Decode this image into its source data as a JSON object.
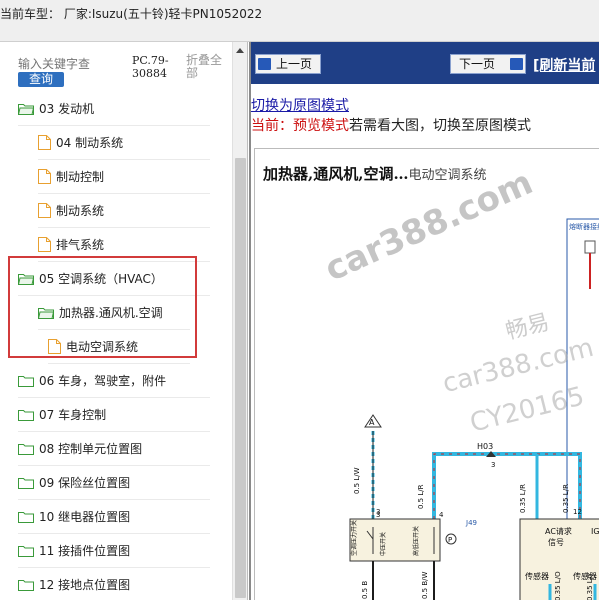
{
  "titlebar": {
    "text": "当前车型： 厂家:Isuzu(五十铃)轻卡PN1052022"
  },
  "sidebar": {
    "search_placeholder": "输入关键字查",
    "search_button": "查询",
    "doc_code": "PC.79-30884",
    "collapse_all": "折叠全部",
    "items": [
      {
        "label": "03 发动机",
        "icon": "folder-icon"
      },
      {
        "label": "04 制动系统",
        "icon": "document-icon"
      },
      {
        "label": "制动控制",
        "icon": "document-icon"
      },
      {
        "label": "制动系统",
        "icon": "document-icon"
      },
      {
        "label": "排气系统",
        "icon": "document-icon"
      },
      {
        "label": "05 空调系统（HVAC）",
        "icon": "folder-icon"
      },
      {
        "label": "加热器.通风机.空调",
        "icon": "folder-icon"
      },
      {
        "label": "电动空调系统",
        "icon": "document-icon"
      },
      {
        "label": "06 车身，驾驶室，附件",
        "icon": "folder-icon"
      },
      {
        "label": "07 车身控制",
        "icon": "folder-icon"
      },
      {
        "label": "08 控制单元位置图",
        "icon": "folder-icon"
      },
      {
        "label": "09 保险丝位置图",
        "icon": "folder-icon"
      },
      {
        "label": "10 继电器位置图",
        "icon": "folder-icon"
      },
      {
        "label": "11 接插件位置图",
        "icon": "folder-icon"
      },
      {
        "label": "12 接地点位置图",
        "icon": "folder-icon"
      }
    ]
  },
  "main": {
    "prev_page": "上一页",
    "next_page": "下一页",
    "refresh": "[刷新当前",
    "switch_mode_link": "切换为原图模式",
    "mode_prefix": "当前：",
    "mode_current": "预览模式",
    "mode_hint": "若需看大图，切换至原图模式",
    "diagram_title": "加热器,通风机,空调…",
    "diagram_subtitle": "电动空调系统"
  },
  "diagram": {
    "fuse_box_label": "熔断器接线盒",
    "connector_a": "A",
    "wire_h03": "H03",
    "wire_05lw": "0.5 L/W",
    "wire_05lr": "0.5 L/R",
    "wire_035lr_1": "0.35 L/R",
    "wire_035lr_2": "0.35 L/R",
    "wire_05bw": "0.5 B/W",
    "wire_05b": "0.5 B",
    "wire_035lo": "0.35 L/O",
    "wire_035ly": "0.35 L/Y",
    "pin_3a": "3",
    "pin_3b": "3",
    "pin_3c": "3",
    "pin_4": "4",
    "pin_12": "12",
    "switch_label_1": "空调压力开关",
    "switch_label_2": "中压开关",
    "switch_label_3": "高低压开关",
    "connector_j49": "J49",
    "ac_request": "AC请求",
    "signal": "信号",
    "ig": "IG",
    "sensor_1": "传感器",
    "sensor_2": "传感器",
    "pressure_symbol": "P"
  },
  "watermarks": {
    "car388": "car388.com",
    "brand": "畅易",
    "car388_2": "car388.com",
    "cy": "CY20165"
  },
  "colors": {
    "nav_strip": "#1f3f86",
    "highlight": "#d23b3b",
    "folder": "#3a9a3a",
    "document": "#e8a030",
    "wire_blue": "#33b7e0",
    "wire_red": "#cc2222"
  }
}
